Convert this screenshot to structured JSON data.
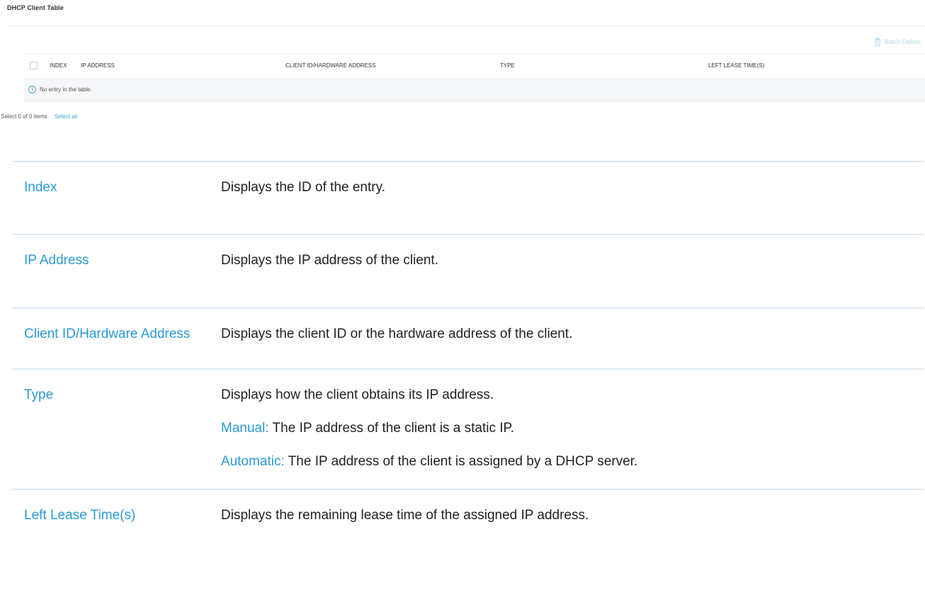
{
  "panel": {
    "title": "DHCP Client Table",
    "batch_delete_label": "Batch Delete",
    "columns": {
      "index": "INDEX",
      "ip": "IP ADDRESS",
      "client": "CLIENT ID/HARDWARE ADDRESS",
      "type": "TYPE",
      "lease": "LEFT LEASE TIME(S)"
    },
    "empty_message": "No entry in the table.",
    "selection_summary": "Select 0 of 0 items",
    "select_all_label": "Select all"
  },
  "descriptions": [
    {
      "term": "Index",
      "definition": "Displays the ID of the entry."
    },
    {
      "term": "IP Address",
      "definition": "Displays the IP address of the client."
    },
    {
      "term": "Client ID/Hardware Address",
      "definition": "Displays the client ID or the hardware address of the client."
    },
    {
      "term": "Type",
      "definition": "Displays how the client obtains its IP address.",
      "options": [
        {
          "keyword": "Manual:",
          "text": " The IP address of the client is a static IP."
        },
        {
          "keyword": "Automatic:",
          "text": " The IP address of the client is assigned by a DHCP server."
        }
      ]
    },
    {
      "term": "Left Lease Time(s)",
      "definition": "Displays the remaining lease time of the assigned IP address."
    }
  ],
  "colors": {
    "accent": "#2b9ad6",
    "faded_action": "#b7dbe8",
    "empty_row_bg": "#f5f6f8"
  }
}
